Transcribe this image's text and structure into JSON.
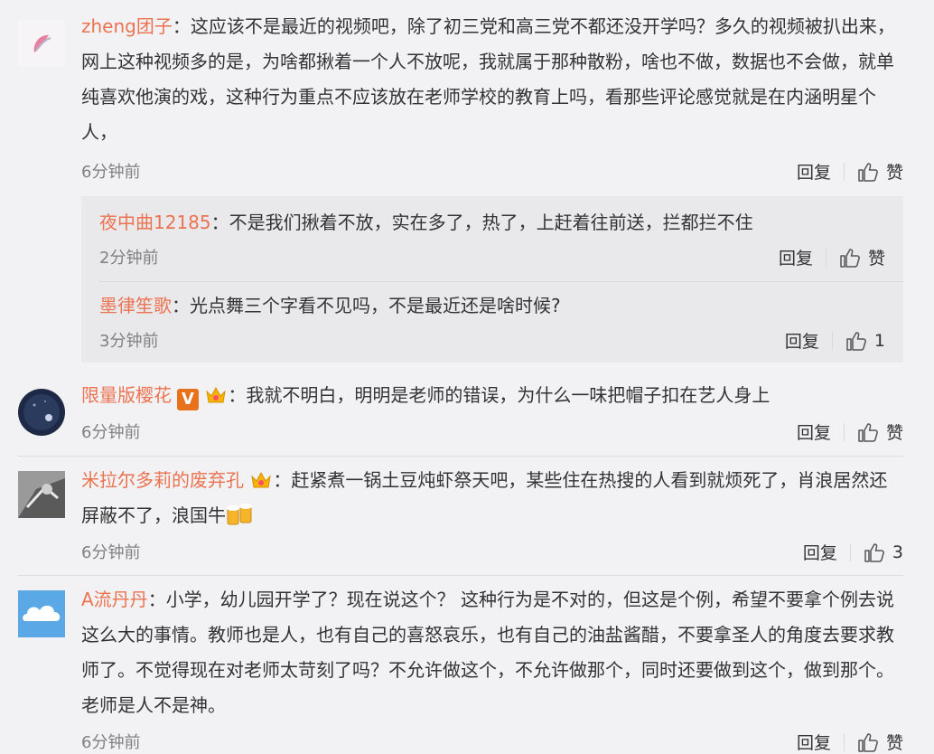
{
  "comments": [
    {
      "username": "zheng团子",
      "text": "这应该不是最近的视频吧，除了初三党和高三党不都还没开学吗？多久的视频被扒出来，网上这种视频多的是，为啥都揪着一个人不放呢，我就属于那种散粉，啥也不做，数据也不会做，就单纯喜欢他演的戏，这种行为重点不应该放在老师学校的教育上吗，看那些评论感觉就是在内涵明星个人，",
      "time": "6分钟前",
      "reply_label": "回复",
      "like_label": "赞",
      "replies": [
        {
          "username": "夜中曲12185",
          "text": "不是我们揪着不放，实在多了，热了，上赶着往前送，拦都拦不住",
          "time": "2分钟前",
          "reply_label": "回复",
          "like_label": "赞"
        },
        {
          "username": "墨律笙歌",
          "text": "光点舞三个字看不见吗，不是最近还是啥时候?",
          "time": "3分钟前",
          "reply_label": "回复",
          "like_label": "1"
        }
      ]
    },
    {
      "username": "限量版樱花",
      "verified_badge": "V",
      "text": "我就不明白，明明是老师的错误，为什么一味把帽子扣在艺人身上",
      "time": "6分钟前",
      "reply_label": "回复",
      "like_label": "赞"
    },
    {
      "username": "米拉尔多莉的废弃孔",
      "text": "赶紧煮一锅土豆炖虾祭天吧，某些住在热搜的人看到就烦死了，肖浪居然还屏蔽不了，浪国牛",
      "time": "6分钟前",
      "reply_label": "回复",
      "like_label": "3"
    },
    {
      "username": "A流丹丹",
      "text": "小学，幼儿园开学了？现在说这个？ 这种行为是不对的，但这是个例，希望不要拿个例去说这么大的事情。教师也是人，也有自己的喜怒哀乐，也有自己的油盐酱醋，不要拿圣人的角度去要求教师了。不觉得现在对老师太苛刻了吗？不允许做这个，不允许做那个，同时还要做到这个，做到那个。老师是人不是神。",
      "time": "6分钟前",
      "reply_label": "回复",
      "like_label": "赞"
    }
  ],
  "colors": {
    "username": "#eb7350",
    "background": "#f2f2f5",
    "reply_box": "#e9e9ec"
  },
  "icons": {
    "like": "thumbs-up-icon",
    "crown_emoji": "crown-emoji-icon",
    "beer_emoji": "beer-emoji-icon"
  }
}
